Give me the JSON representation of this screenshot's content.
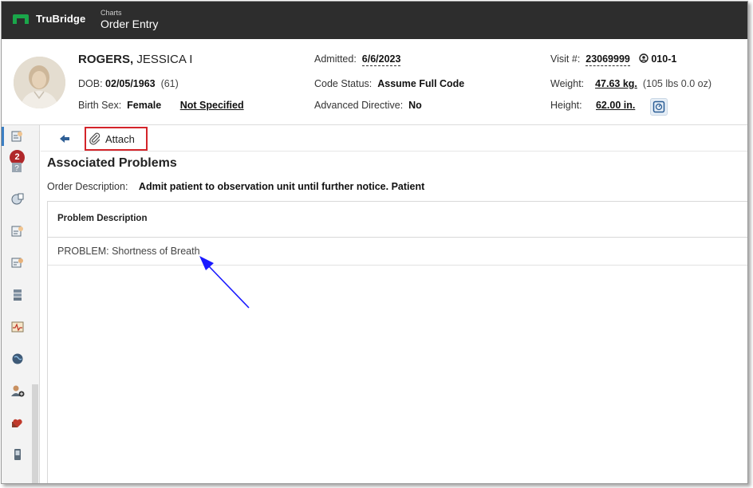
{
  "app": {
    "brand": "TruBridge",
    "breadcrumb_section": "Charts",
    "breadcrumb_page": "Order Entry"
  },
  "patient": {
    "last_name": "ROGERS,",
    "first_name": "JESSICA I",
    "dob_label": "DOB:",
    "dob": "02/05/1963",
    "age": "(61)",
    "sex_label": "Birth Sex:",
    "sex": "Female",
    "gender_identity": "Not Specified",
    "admitted_label": "Admitted:",
    "admitted": "6/6/2023",
    "code_status_label": "Code Status:",
    "code_status": "Assume Full Code",
    "advanced_directive_label": "Advanced Directive:",
    "advanced_directive": "No",
    "visit_label": "Visit #:",
    "visit": "23069999",
    "room": "010-1",
    "weight_label": "Weight:",
    "weight": "47.63 kg.",
    "weight_lbs": "(105 lbs 0.0 oz)",
    "height_label": "Height:",
    "height": "62.00 in."
  },
  "rail": {
    "badge_count": "2",
    "icons": [
      "order-icon",
      "help-icon",
      "globe-meds-icon",
      "notes-icon",
      "chat-icon",
      "stack-icon",
      "vitals-icon",
      "world-icon",
      "add-user-icon",
      "heart-icon",
      "device-icon"
    ]
  },
  "toolbar": {
    "attach_label": "Attach"
  },
  "main": {
    "title": "Associated Problems",
    "order_description_label": "Order Description:",
    "order_description": "Admit patient to observation unit until further notice. Patient",
    "columns": [
      "Problem Description"
    ],
    "rows": [
      {
        "problem": "PROBLEM: Shortness of Breath"
      }
    ]
  },
  "colors": {
    "topbar": "#2d2d2d",
    "brand_green": "#1aa64a",
    "attach_highlight": "#d4242a",
    "annotation_arrow": "#1a1aff",
    "badge": "#b0282b"
  }
}
